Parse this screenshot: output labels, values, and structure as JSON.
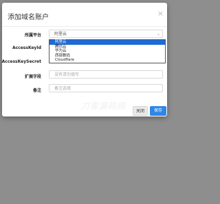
{
  "modal": {
    "title": "添加域名账户",
    "close_glyph": "×"
  },
  "form": {
    "platform_label": "所属平台",
    "platform_value": "阿里云",
    "accesskeyid_label": "AccessKeyId",
    "accesskeysecret_label": "AccessKeySecret",
    "extra_label": "扩展字段",
    "extra_placeholder": "没有请勿填写",
    "remark_label": "备注",
    "remark_placeholder": "备注选填"
  },
  "dropdown": {
    "options": [
      "阿里云",
      "腾讯云",
      "华为云",
      "西部数码",
      "Cloudflare"
    ],
    "selected_index": 0
  },
  "buttons": {
    "cancel_label": "关闭",
    "save_label": "保存"
  },
  "watermark": "刀客源码网",
  "colors": {
    "primary": "#2f86e9",
    "dropdown_selected": "#1e6ad6",
    "overlay": "#8e8e8e"
  }
}
